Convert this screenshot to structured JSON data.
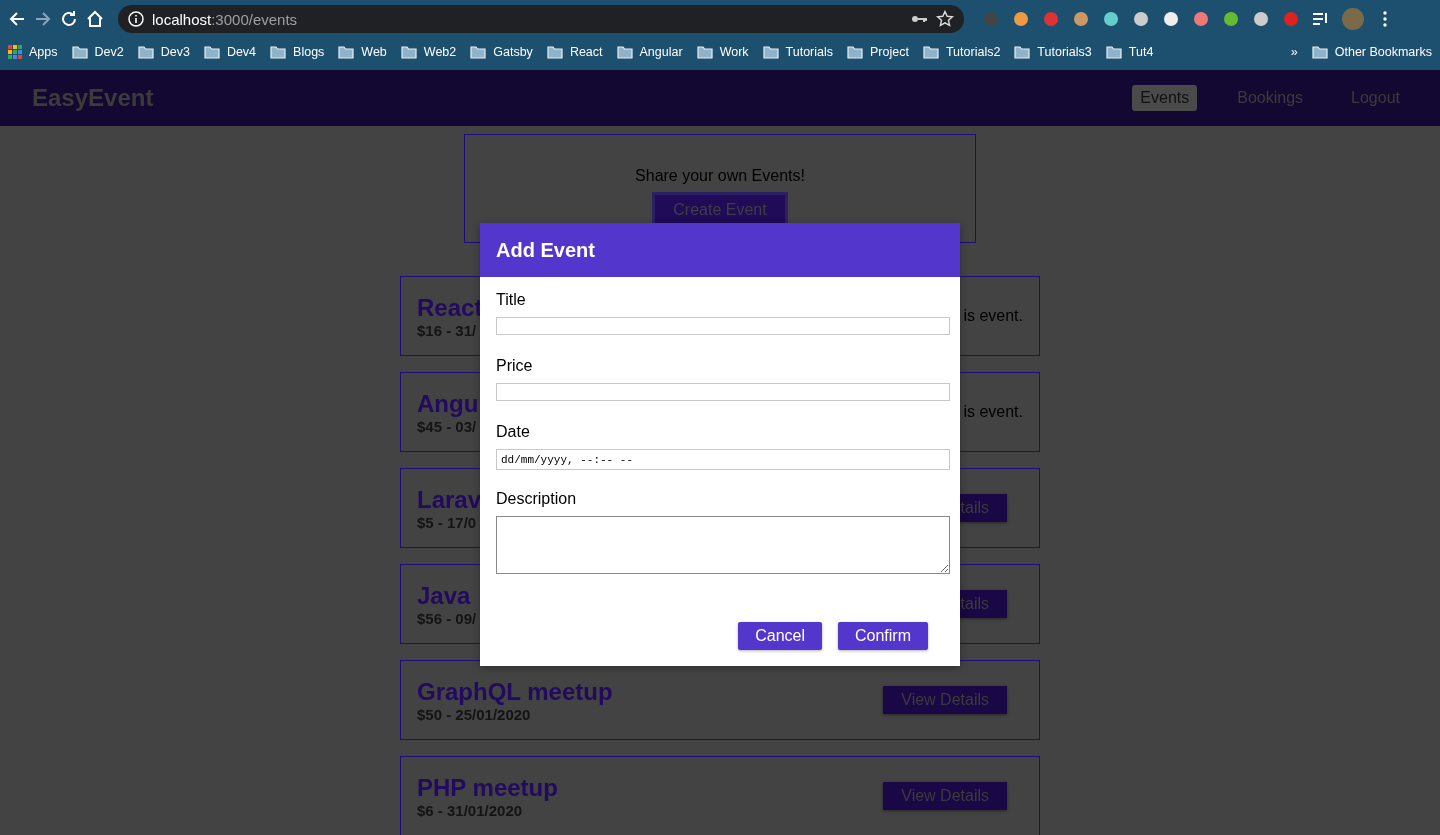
{
  "browser": {
    "url_host": "localhost",
    "url_path": ":3000/events",
    "bookmarks": [
      {
        "label": "Apps",
        "kind": "apps"
      },
      {
        "label": "Dev2",
        "kind": "folder"
      },
      {
        "label": "Dev3",
        "kind": "folder"
      },
      {
        "label": "Dev4",
        "kind": "folder"
      },
      {
        "label": "Blogs",
        "kind": "folder"
      },
      {
        "label": "Web",
        "kind": "folder"
      },
      {
        "label": "Web2",
        "kind": "folder"
      },
      {
        "label": "Gatsby",
        "kind": "folder"
      },
      {
        "label": "React",
        "kind": "folder"
      },
      {
        "label": "Angular",
        "kind": "folder"
      },
      {
        "label": "Work",
        "kind": "folder"
      },
      {
        "label": "Tutorials",
        "kind": "folder"
      },
      {
        "label": "Project",
        "kind": "folder"
      },
      {
        "label": "Tutorials2",
        "kind": "folder"
      },
      {
        "label": "Tutorials3",
        "kind": "folder"
      },
      {
        "label": "Tut4",
        "kind": "folder"
      }
    ],
    "overflow": "»",
    "other_bookmarks": "Other Bookmarks"
  },
  "navbar": {
    "brand": "EasyEvent",
    "items": [
      {
        "label": "Events",
        "selected": true
      },
      {
        "label": "Bookings",
        "selected": false
      },
      {
        "label": "Logout",
        "selected": false
      }
    ]
  },
  "create_panel": {
    "text": "Share your own Events!",
    "button": "Create Event"
  },
  "events": [
    {
      "title": "React",
      "meta": "$16 - 31/",
      "kind": "owner",
      "right": "is event."
    },
    {
      "title": "Angu",
      "meta": "$45 - 03/",
      "kind": "owner",
      "right": "is event."
    },
    {
      "title": "Larav",
      "meta": "$5 - 17/0",
      "kind": "button",
      "right": "tails"
    },
    {
      "title": "Java",
      "meta": "$56 - 09/",
      "kind": "button",
      "right": "tails"
    },
    {
      "title": "GraphQL meetup",
      "meta": "$50 - 25/01/2020",
      "kind": "button",
      "right": "View Details"
    },
    {
      "title": "PHP meetup",
      "meta": "$6 - 31/01/2020",
      "kind": "button",
      "right": "View Details"
    }
  ],
  "modal": {
    "title": "Add Event",
    "fields": [
      {
        "label": "Title",
        "kind": "text"
      },
      {
        "label": "Price",
        "kind": "text"
      },
      {
        "label": "Date",
        "kind": "date",
        "value": "dd/mm/yyyy, --:-- --"
      },
      {
        "label": "Description",
        "kind": "textarea"
      }
    ],
    "buttons": [
      "Cancel",
      "Confirm"
    ]
  }
}
